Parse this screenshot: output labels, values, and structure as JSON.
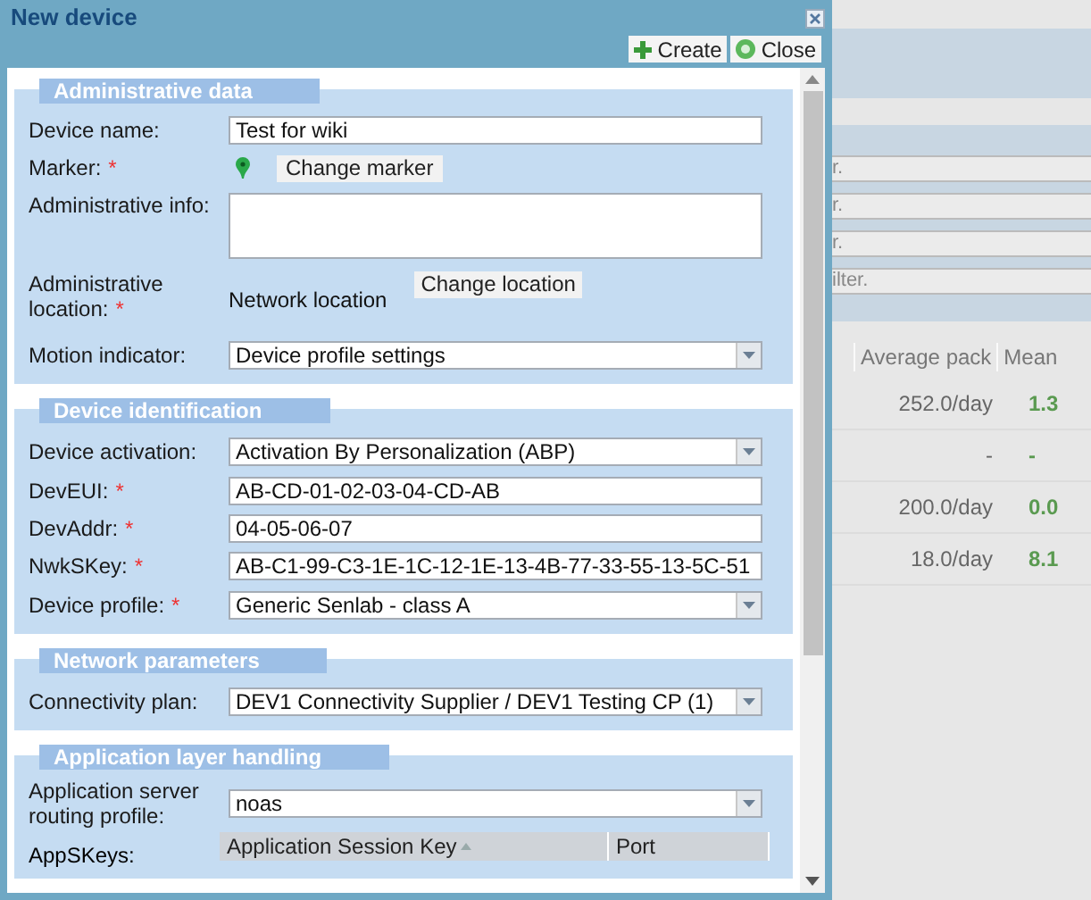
{
  "window": {
    "title": "New device"
  },
  "toolbar": [
    {
      "label": "Create",
      "kind": "create"
    },
    {
      "label": "Close",
      "kind": "close"
    }
  ],
  "sections": [
    {
      "title": "Administrative data",
      "fields": [
        {
          "kind": "text",
          "label": "Device name:",
          "value": "Test for wiki"
        },
        {
          "kind": "marker",
          "label": "Marker:",
          "mark": "*",
          "button": "Change marker"
        },
        {
          "kind": "textarea",
          "label": "Administrative info:"
        },
        {
          "kind": "location",
          "label": "Administrative location:",
          "mark": "*",
          "value": "Network location",
          "button": "Change location"
        },
        {
          "kind": "select",
          "label": "Motion indicator:",
          "value": "Device profile settings"
        }
      ]
    },
    {
      "title": "Device identification",
      "fields": [
        {
          "kind": "select",
          "label": "Device activation:",
          "value": "Activation By Personalization (ABP)"
        },
        {
          "kind": "text",
          "label": "DevEUI:",
          "mark": "*",
          "value": "AB-CD-01-02-03-04-CD-AB"
        },
        {
          "kind": "text",
          "label": "DevAddr:",
          "mark": "*",
          "value": "04-05-06-07"
        },
        {
          "kind": "text",
          "label": "NwkSKey:",
          "mark": "*",
          "value": "AB-C1-99-C3-1E-1C-12-1E-13-4B-77-33-55-13-5C-51"
        },
        {
          "kind": "select",
          "label": "Device profile:",
          "mark": "*",
          "value": "Generic Senlab - class A"
        }
      ]
    },
    {
      "title": "Network parameters",
      "fields": [
        {
          "kind": "select",
          "label": "Connectivity plan:",
          "value": "DEV1 Connectivity Supplier / DEV1 Testing CP (1)"
        }
      ]
    },
    {
      "title": "Application layer handling",
      "fields": [
        {
          "kind": "select",
          "label": "Application server routing profile:",
          "value": "noas"
        },
        {
          "kind": "grid",
          "label": "AppSKeys:",
          "columns": [
            {
              "label": "Application Session Key",
              "sorted": true
            },
            {
              "label": "Port",
              "sorted": false
            }
          ]
        }
      ]
    }
  ],
  "background": {
    "filters": [
      "r.",
      "r.",
      "r.",
      "ilter."
    ],
    "columns": [
      "Average pack",
      "Mean"
    ],
    "rows": [
      {
        "column_1": "252.0/day",
        "column_2": "1.3"
      },
      {
        "column_1": "-",
        "column_2": "-"
      },
      {
        "column_1": "200.0/day",
        "column_2": "0.0"
      },
      {
        "column_1": "18.0/day",
        "column_2": "8.1"
      }
    ]
  }
}
